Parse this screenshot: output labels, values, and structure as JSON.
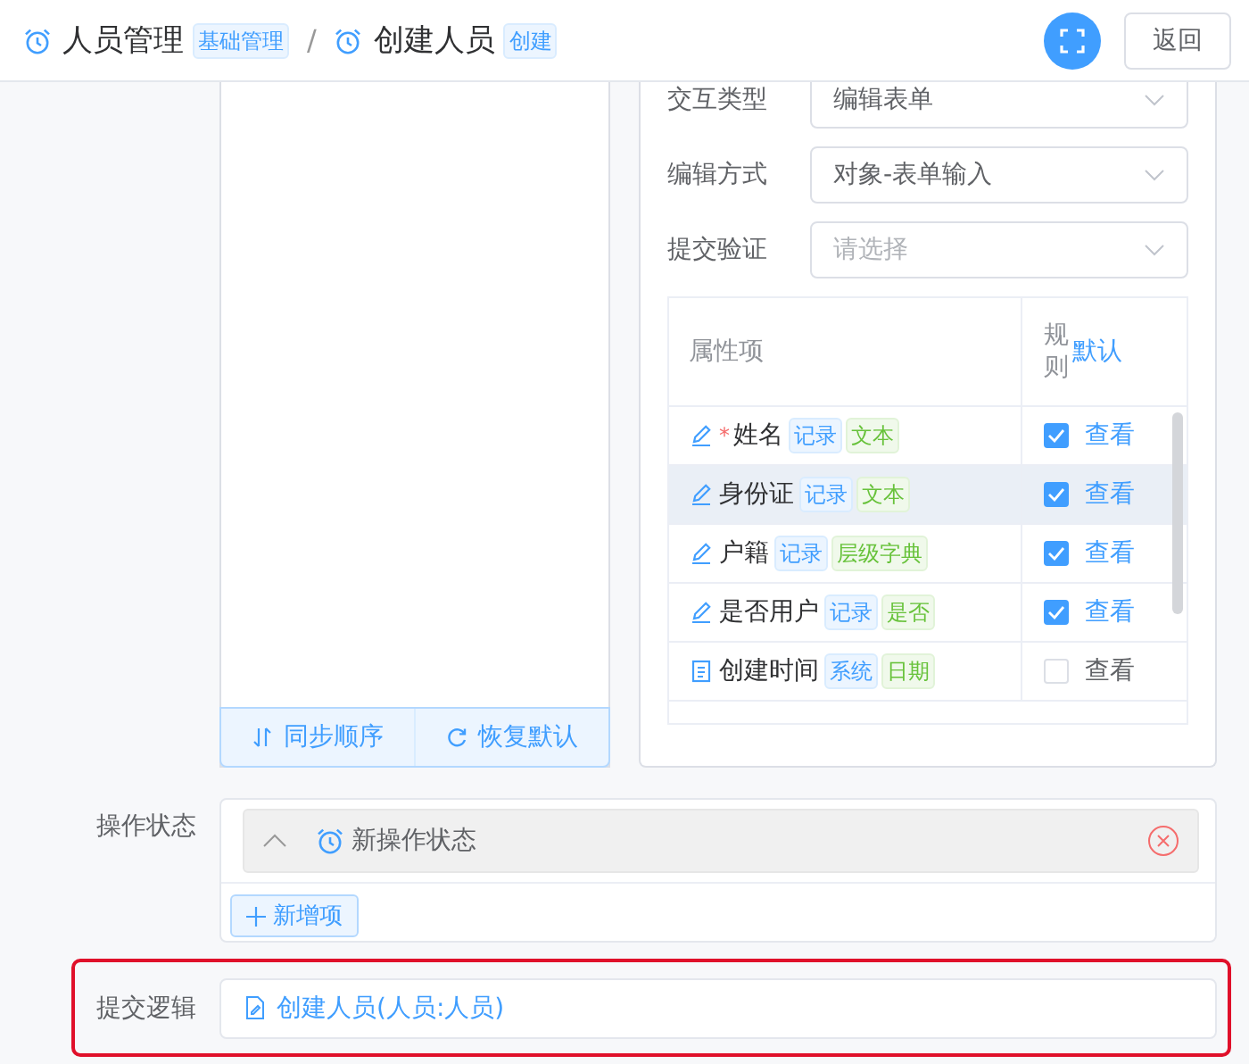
{
  "header": {
    "breadcrumbs": [
      {
        "title": "人员管理",
        "tag": "基础管理"
      },
      {
        "title": "创建人员",
        "tag": "创建"
      }
    ],
    "separator": "/",
    "back_button": "返回"
  },
  "sort_panel": {
    "buttons": [
      {
        "label": "同步顺序"
      },
      {
        "label": "恢复默认"
      }
    ]
  },
  "form": {
    "fields": [
      {
        "label": "交互类型",
        "value": "编辑表单"
      },
      {
        "label": "编辑方式",
        "value": "对象-表单输入"
      },
      {
        "label": "提交验证",
        "placeholder": "请选择"
      }
    ]
  },
  "table": {
    "columns": [
      "属性项",
      "规则"
    ],
    "rule_actions": [
      "默认"
    ],
    "rows": [
      {
        "kind": "edit",
        "name": "姓名",
        "required_mark": "*",
        "tags": [
          {
            "text": "记录",
            "kind": "source"
          },
          {
            "text": "文本",
            "kind": "type"
          }
        ],
        "checked": true,
        "action": "查看",
        "selected": false
      },
      {
        "kind": "edit",
        "name": "身份证",
        "tags": [
          {
            "text": "记录",
            "kind": "source"
          },
          {
            "text": "文本",
            "kind": "type"
          }
        ],
        "checked": true,
        "action": "查看",
        "selected": true
      },
      {
        "kind": "edit",
        "name": "户籍",
        "tags": [
          {
            "text": "记录",
            "kind": "source"
          },
          {
            "text": "层级字典",
            "kind": "type"
          }
        ],
        "checked": true,
        "action": "查看",
        "selected": false
      },
      {
        "kind": "edit",
        "name": "是否用户",
        "tags": [
          {
            "text": "记录",
            "kind": "source"
          },
          {
            "text": "是否",
            "kind": "type"
          }
        ],
        "checked": true,
        "action": "查看",
        "selected": false
      },
      {
        "kind": "system",
        "name": "创建时间",
        "tags": [
          {
            "text": "系统",
            "kind": "source"
          },
          {
            "text": "日期",
            "kind": "type"
          }
        ],
        "checked": false,
        "action": "查看",
        "selected": false
      }
    ]
  },
  "operation_states": {
    "label": "操作状态",
    "items": [
      {
        "title": "新操作状态"
      }
    ],
    "add_button": "新增项"
  },
  "submit_logic": {
    "label": "提交逻辑",
    "value": "创建人员(人员:人员)",
    "highlighted": true
  }
}
